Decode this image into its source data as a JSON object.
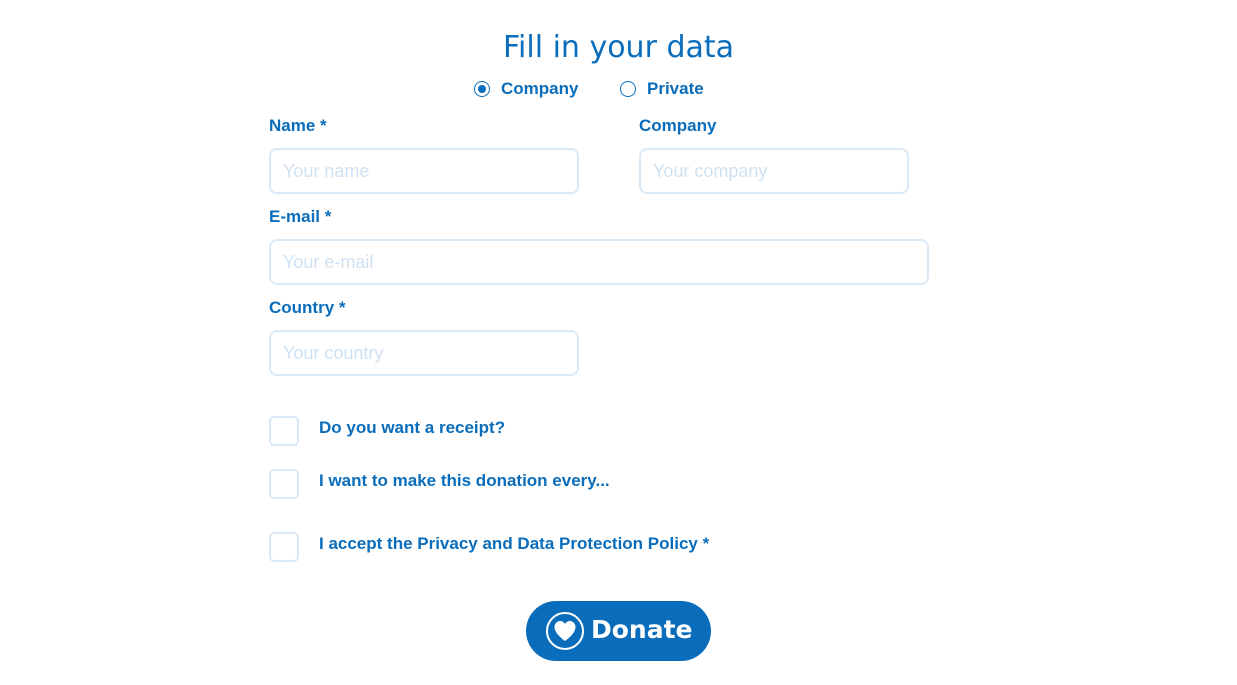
{
  "form": {
    "title": "Fill in your data",
    "type_options": [
      {
        "label": "Company",
        "selected": true
      },
      {
        "label": "Private",
        "selected": false
      }
    ],
    "name": {
      "label": "Name *",
      "placeholder": "Your name"
    },
    "company": {
      "label": "Company",
      "placeholder": "Your company"
    },
    "email": {
      "label": "E-mail *",
      "placeholder": "Your e-mail"
    },
    "country": {
      "label": "Country *",
      "placeholder": "Your country"
    },
    "checkboxes": [
      {
        "label": "Do you want a receipt?",
        "checked": false
      },
      {
        "label": "I want to make this donation every...",
        "checked": false
      },
      {
        "label": "I accept the Privacy and Data Protection Policy *",
        "checked": false
      }
    ],
    "donate_label": "Donate"
  },
  "colors": {
    "accent": "#0a6dbb",
    "field_border": "#dbe9f6",
    "placeholder": "#cfe2f3",
    "background": "#ffffff"
  },
  "icons": {
    "donate": "heart-icon"
  }
}
